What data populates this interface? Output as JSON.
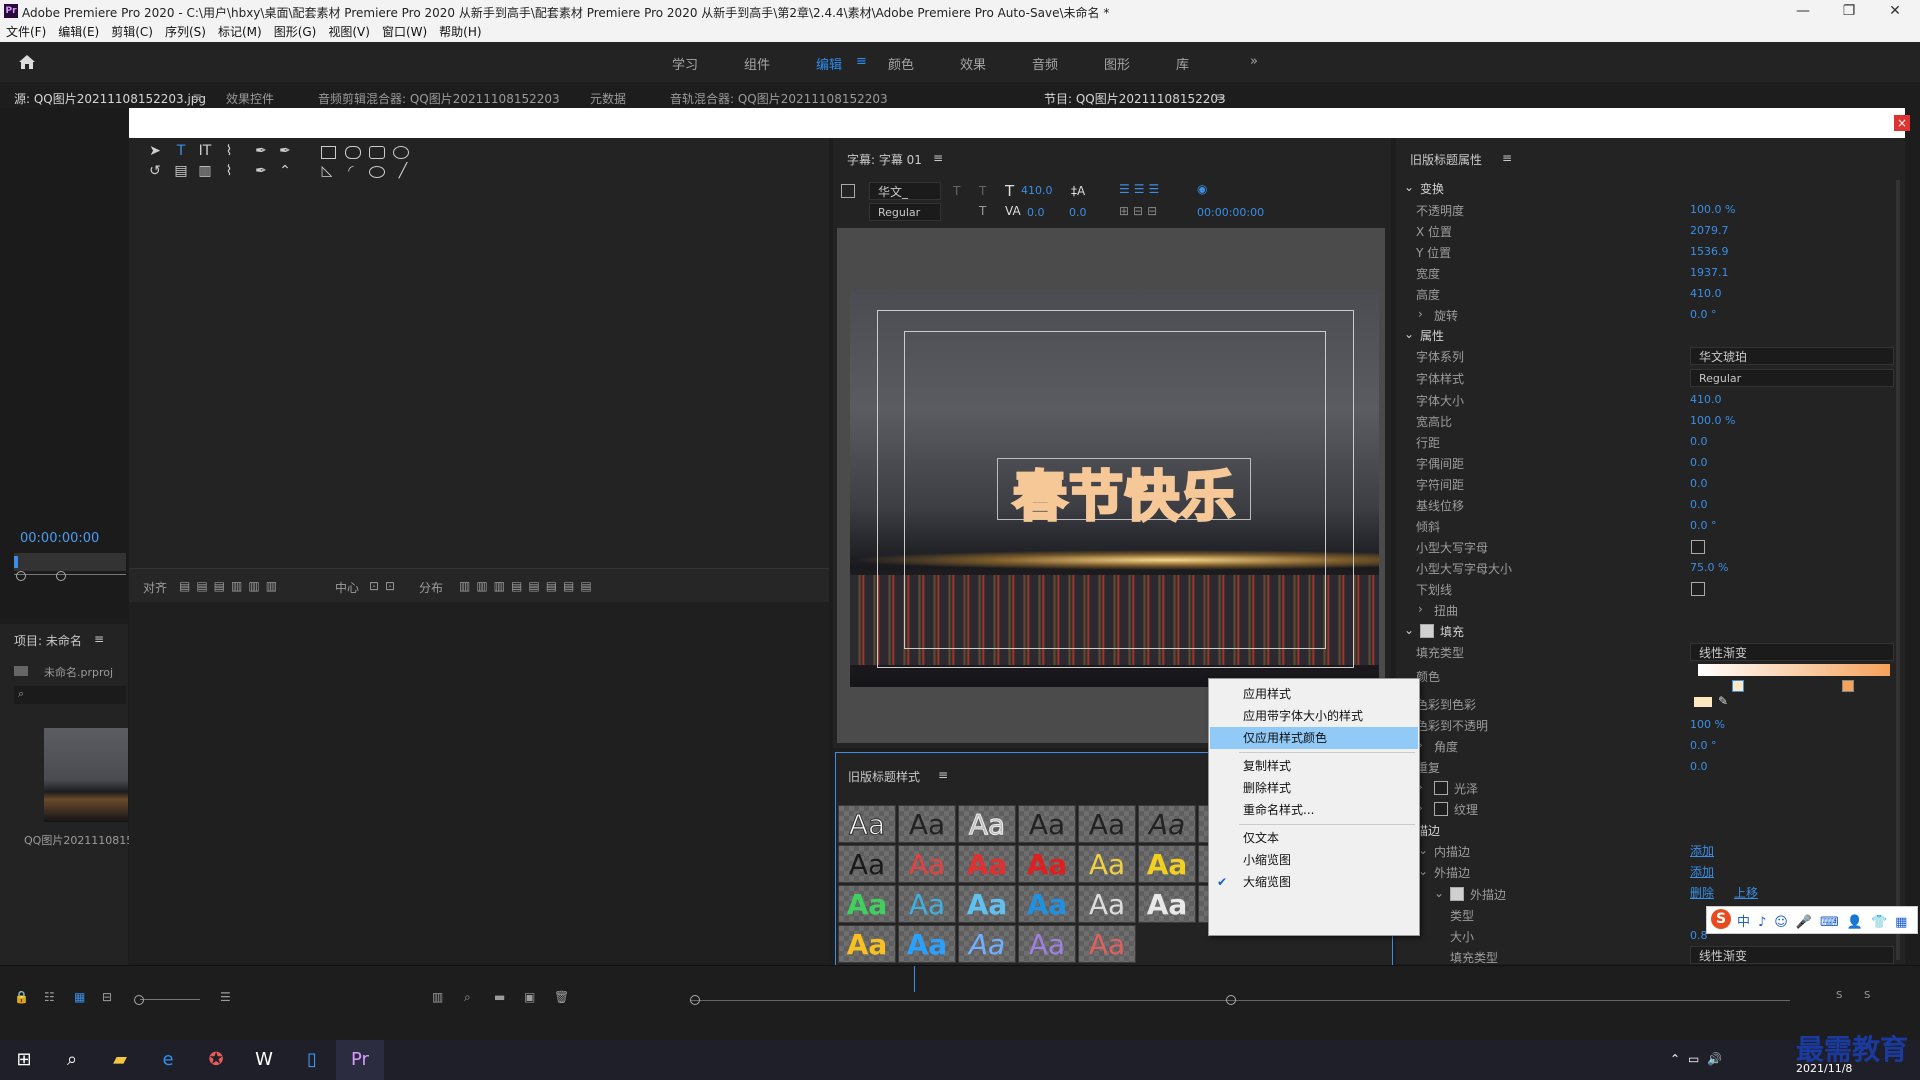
{
  "window": {
    "title": "Adobe Premiere Pro 2020 - C:\\用户\\hbxy\\桌面\\配套素材 Premiere Pro 2020 从新手到高手\\配套素材 Premiere Pro 2020 从新手到高手\\第2章\\2.4.4\\素材\\Adobe Premiere Pro Auto-Save\\未命名 *",
    "logo": "Pr",
    "minimize": "—",
    "maximize": "❐",
    "close": "✕"
  },
  "menu": [
    "文件(F)",
    "编辑(E)",
    "剪辑(C)",
    "序列(S)",
    "标记(M)",
    "图形(G)",
    "视图(V)",
    "窗口(W)",
    "帮助(H)"
  ],
  "workspaces": {
    "items": [
      "学习",
      "组件",
      "编辑",
      "颜色",
      "效果",
      "音频",
      "图形",
      "库"
    ],
    "active": "编辑",
    "more": "»"
  },
  "tabs": {
    "source": "源: QQ图片20211108152203.jpg",
    "effect_controls": "效果控件",
    "audio_mixer": "音频剪辑混合器: QQ图片20211108152203",
    "metadata": "元数据",
    "track_mixer": "音轨混合器: QQ图片20211108152203",
    "program": "节目: QQ图片20211108152203",
    "menu_glyph": "≡"
  },
  "source": {
    "timecode": "00:00:00:00"
  },
  "project": {
    "title": "项目: 未命名",
    "file": "未命名.prproj",
    "clip_name": "QQ图片2021110815"
  },
  "align_bar": {
    "align": "对齐",
    "center": "中心",
    "distribute": "分布"
  },
  "title_panel": {
    "header": "字幕: 字幕 01",
    "font": "华文_",
    "style": "Regular",
    "size": "410.0",
    "kerning": "0.0",
    "leading": "0.0",
    "timecode": "00:00:00:00",
    "caption_text": "春节快乐"
  },
  "styles_panel": {
    "header": "旧版标题样式",
    "swatch_text": "Aa"
  },
  "properties": {
    "header": "旧版标题属性",
    "transform": {
      "label": "变换",
      "opacity": {
        "label": "不透明度",
        "value": "100.0 %"
      },
      "x": {
        "label": "X 位置",
        "value": "2079.7"
      },
      "y": {
        "label": "Y 位置",
        "value": "1536.9"
      },
      "width": {
        "label": "宽度",
        "value": "1937.1"
      },
      "height": {
        "label": "高度",
        "value": "410.0"
      },
      "rotation": {
        "label": "旋转",
        "value": "0.0 °"
      }
    },
    "attributes": {
      "label": "属性",
      "font_family": {
        "label": "字体系列",
        "value": "华文琥珀"
      },
      "font_style": {
        "label": "字体样式",
        "value": "Regular"
      },
      "font_size": {
        "label": "字体大小",
        "value": "410.0"
      },
      "aspect": {
        "label": "宽高比",
        "value": "100.0 %"
      },
      "leading": {
        "label": "行距",
        "value": "0.0"
      },
      "kerning": {
        "label": "字偶间距",
        "value": "0.0"
      },
      "tracking": {
        "label": "字符间距",
        "value": "0.0"
      },
      "baseline": {
        "label": "基线位移",
        "value": "0.0"
      },
      "slant": {
        "label": "倾斜",
        "value": "0.0 °"
      },
      "small_caps": {
        "label": "小型大写字母"
      },
      "small_caps_size": {
        "label": "小型大写字母大小",
        "value": "75.0 %"
      },
      "underline": {
        "label": "下划线"
      },
      "distort": {
        "label": "扭曲"
      }
    },
    "fill": {
      "label": "填充",
      "type": {
        "label": "填充类型",
        "value": "线性渐变"
      },
      "color": {
        "label": "颜色"
      },
      "color_to_color": {
        "label": "色彩到色彩"
      },
      "color_opacity": {
        "label": "色彩到不透明",
        "value": "100 %"
      },
      "angle": {
        "label": "角度",
        "value": "0.0 °"
      },
      "repeat": {
        "label": "重复",
        "value": "0.0"
      },
      "sheen": {
        "label": "光泽"
      },
      "texture": {
        "label": "纹理"
      }
    },
    "stroke": {
      "label": "描边",
      "inner": {
        "label": "内描边",
        "action": "添加"
      },
      "outer": {
        "label": "外描边",
        "action": "添加"
      },
      "delete": "删除",
      "move_up": "上移",
      "outer_item": "外描边",
      "type": {
        "label": "类型"
      },
      "size": {
        "label": "大小",
        "value": "0.8"
      },
      "fill_type": {
        "label": "填充类型",
        "value": "线性渐变"
      }
    },
    "gradient_start": "#ffffff",
    "gradient_end": "#f5a25a"
  },
  "context_menu": {
    "items": [
      "应用样式",
      "应用带字体大小的样式",
      "仅应用样式颜色",
      "复制样式",
      "删除样式",
      "重命名样式...",
      "仅文本",
      "小缩览图",
      "大缩览图"
    ],
    "highlighted": "仅应用样式颜色",
    "checked": "大缩览图",
    "check_glyph": "✔"
  },
  "taskbar": {
    "date": "2021/11/8"
  },
  "watermark": "最需教育",
  "colors": {
    "accent": "#2d8ceb",
    "value_blue": "#3a8ee6",
    "highlight": "#91c9f7"
  }
}
